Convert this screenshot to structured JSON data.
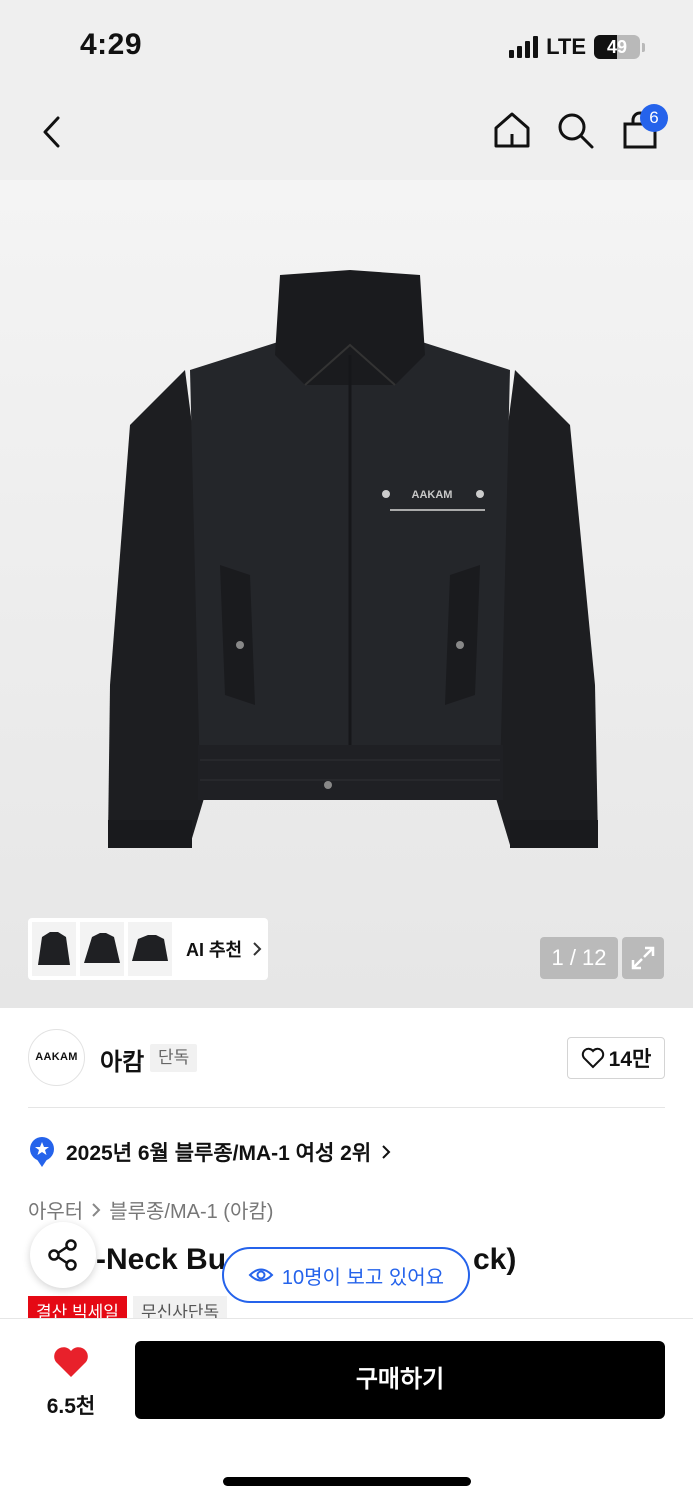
{
  "status_bar": {
    "time": "4:29",
    "network": "LTE",
    "battery_level": "49",
    "battery_percent": 49
  },
  "nav": {
    "back_icon": "chevron-left-icon",
    "home_icon": "home-icon",
    "search_icon": "search-icon",
    "cart_icon": "shopping-bag-icon",
    "cart_count": "6"
  },
  "gallery": {
    "jacket_logo_text": "AAKAM",
    "ai_recommend_label": "AI 추천",
    "image_counter": "1 / 12",
    "expand_icon": "expand-icon"
  },
  "brand": {
    "logo_text": "AAKAM",
    "name": "아캄",
    "exclusive_tag": "단독",
    "like_count": "14만"
  },
  "ranking": {
    "text": "2025년 6월 블루종/MA-1 여성 2위"
  },
  "breadcrumb": {
    "level1": "아우터",
    "level2": "블루종/MA-1 (아캄)"
  },
  "product": {
    "title_visible_left": "-Neck Bu",
    "title_visible_right": "ck)",
    "viewers_text": "10명이 보고 있어요",
    "tags": [
      "결산 빅세일",
      "무신사단독"
    ]
  },
  "bottom_bar": {
    "wish_count": "6.5천",
    "buy_label": "구매하기"
  },
  "colors": {
    "accent_blue": "#2563eb",
    "sale_red": "#e50914",
    "heart_red": "#e8212b",
    "buy_button": "#000000"
  }
}
